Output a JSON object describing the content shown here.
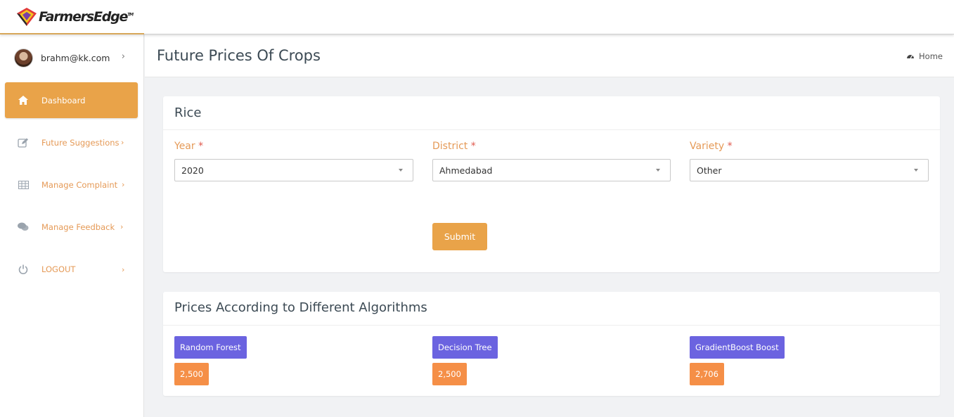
{
  "brand": {
    "name": "FarmersEdge",
    "tm": "TM"
  },
  "sidebar": {
    "user_email": "brahm@kk.com",
    "items": [
      {
        "label": "Dashboard",
        "icon": "home-icon"
      },
      {
        "label": "Future Suggestions",
        "icon": "edit-icon"
      },
      {
        "label": "Manage Complaint",
        "icon": "table-icon"
      },
      {
        "label": "Manage Feedback",
        "icon": "comments-icon"
      },
      {
        "label": "LOGOUT",
        "icon": "power-icon"
      }
    ]
  },
  "header": {
    "title": "Future Prices Of Crops",
    "breadcrumb": "Home"
  },
  "form_card": {
    "title": "Rice",
    "fields": {
      "year": {
        "label": "Year",
        "required_mark": "*",
        "value": "2020"
      },
      "district": {
        "label": "District",
        "required_mark": "*",
        "value": "Ahmedabad"
      },
      "variety": {
        "label": "Variety",
        "required_mark": "*",
        "value": "Other"
      }
    },
    "submit_label": "Submit"
  },
  "results_card": {
    "title": "Prices According to Different Algorithms",
    "results": [
      {
        "algorithm": "Random Forest",
        "price": "2,500"
      },
      {
        "algorithm": "Decision Tree",
        "price": "2,500"
      },
      {
        "algorithm": "GradientBoost Boost",
        "price": "2,706"
      }
    ]
  },
  "colors": {
    "accent_orange": "#e9a349",
    "label_orange": "#e59a57",
    "algo_purple": "#6b63e0",
    "price_orange": "#f58f47"
  }
}
